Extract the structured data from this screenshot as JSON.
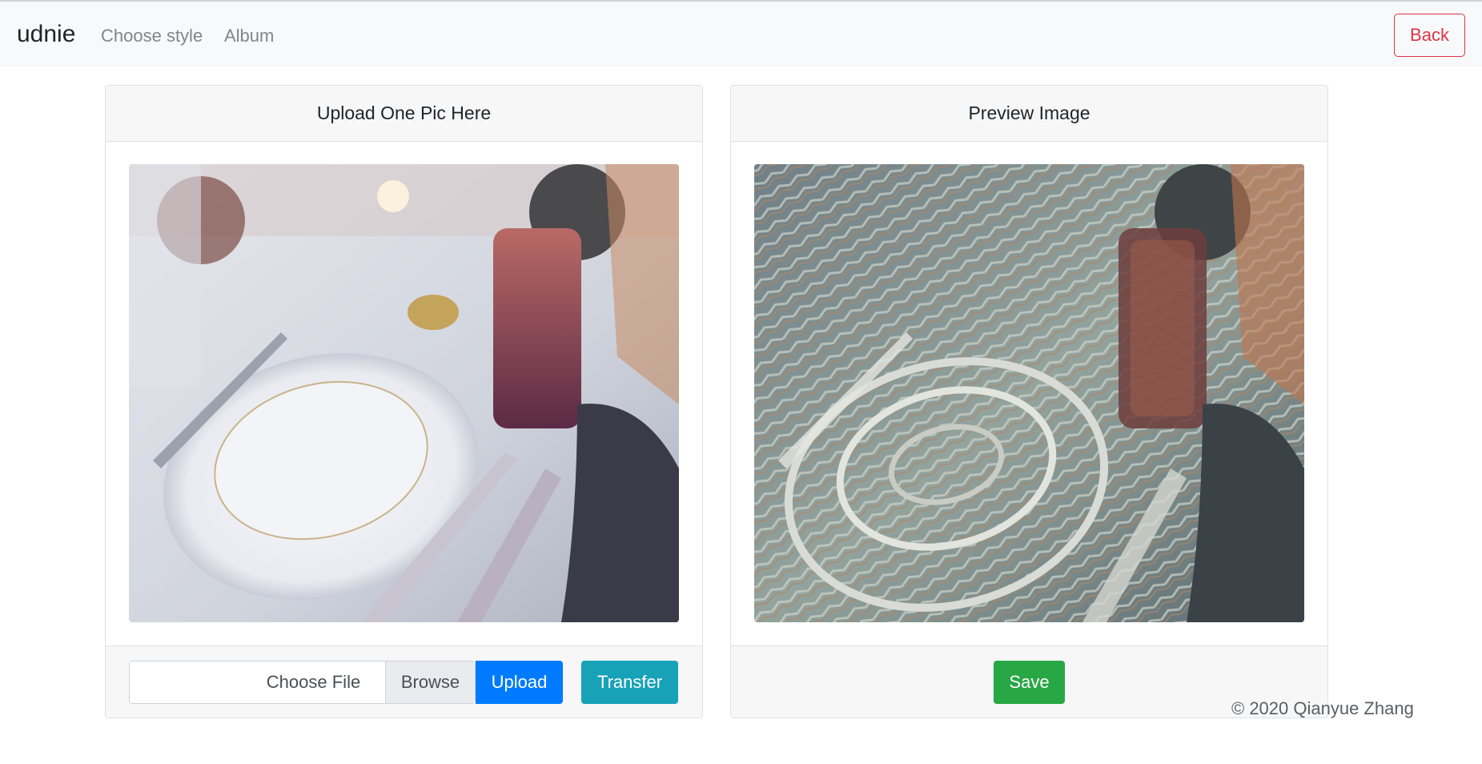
{
  "navbar": {
    "brand": "udnie",
    "links": [
      "Choose style",
      "Album"
    ],
    "back_label": "Back"
  },
  "upload_card": {
    "header": "Upload One Pic Here",
    "image_alt": "Table setting with plates, glasses and cutlery",
    "file_placeholder": "Choose File",
    "browse_label": "Browse",
    "upload_label": "Upload",
    "transfer_label": "Transfer"
  },
  "preview_card": {
    "header": "Preview Image",
    "image_alt": "Stylized table setting preview",
    "save_label": "Save"
  },
  "footer": {
    "copyright": "© 2020 Qianyue Zhang"
  },
  "colors": {
    "danger": "#dc3545",
    "primary": "#007bff",
    "info": "#17a2b8",
    "success": "#28a745"
  }
}
